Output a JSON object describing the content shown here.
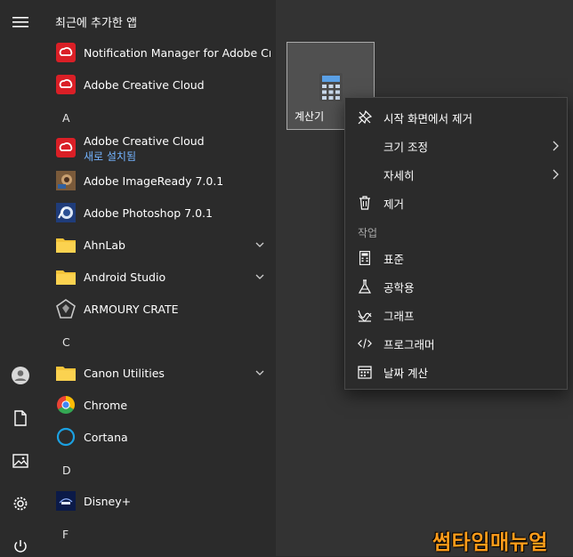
{
  "start_menu": {
    "recent_header": "최근에 추가한 앱",
    "rail": {
      "menu_icon": "hamburger-icon",
      "user_icon": "user-icon",
      "documents_icon": "document-icon",
      "pictures_icon": "image-icon",
      "settings_icon": "gear-icon",
      "power_icon": "power-icon"
    },
    "apps": [
      {
        "label": "Notification Manager for Adobe Cre..."
      },
      {
        "label": "Adobe Creative Cloud"
      },
      {
        "letter": "A"
      },
      {
        "label": "Adobe Creative Cloud",
        "sub": "새로 설치됨"
      },
      {
        "label": "Adobe ImageReady 7.0.1"
      },
      {
        "label": "Adobe Photoshop 7.0.1"
      },
      {
        "label": "AhnLab"
      },
      {
        "label": "Android Studio"
      },
      {
        "label": "ARMOURY CRATE"
      },
      {
        "letter": "C"
      },
      {
        "label": "Canon Utilities"
      },
      {
        "label": "Chrome"
      },
      {
        "label": "Cortana"
      },
      {
        "letter": "D"
      },
      {
        "label": "Disney+"
      },
      {
        "letter": "F"
      }
    ]
  },
  "tile": {
    "label": "계산기"
  },
  "context_menu": {
    "items": [
      {
        "label": "시작 화면에서 제거"
      },
      {
        "label": "크기 조정"
      },
      {
        "label": "자세히"
      },
      {
        "label": "제거"
      }
    ],
    "tasks_header": "작업",
    "tasks": [
      {
        "label": "표준"
      },
      {
        "label": "공학용"
      },
      {
        "label": "그래프"
      },
      {
        "label": "프로그래머"
      },
      {
        "label": "날짜 계산"
      }
    ]
  },
  "watermark": "썸타임매뉴얼",
  "colors": {
    "accent_sub": "#74b4ff",
    "watermark": "#ff9c1a"
  }
}
